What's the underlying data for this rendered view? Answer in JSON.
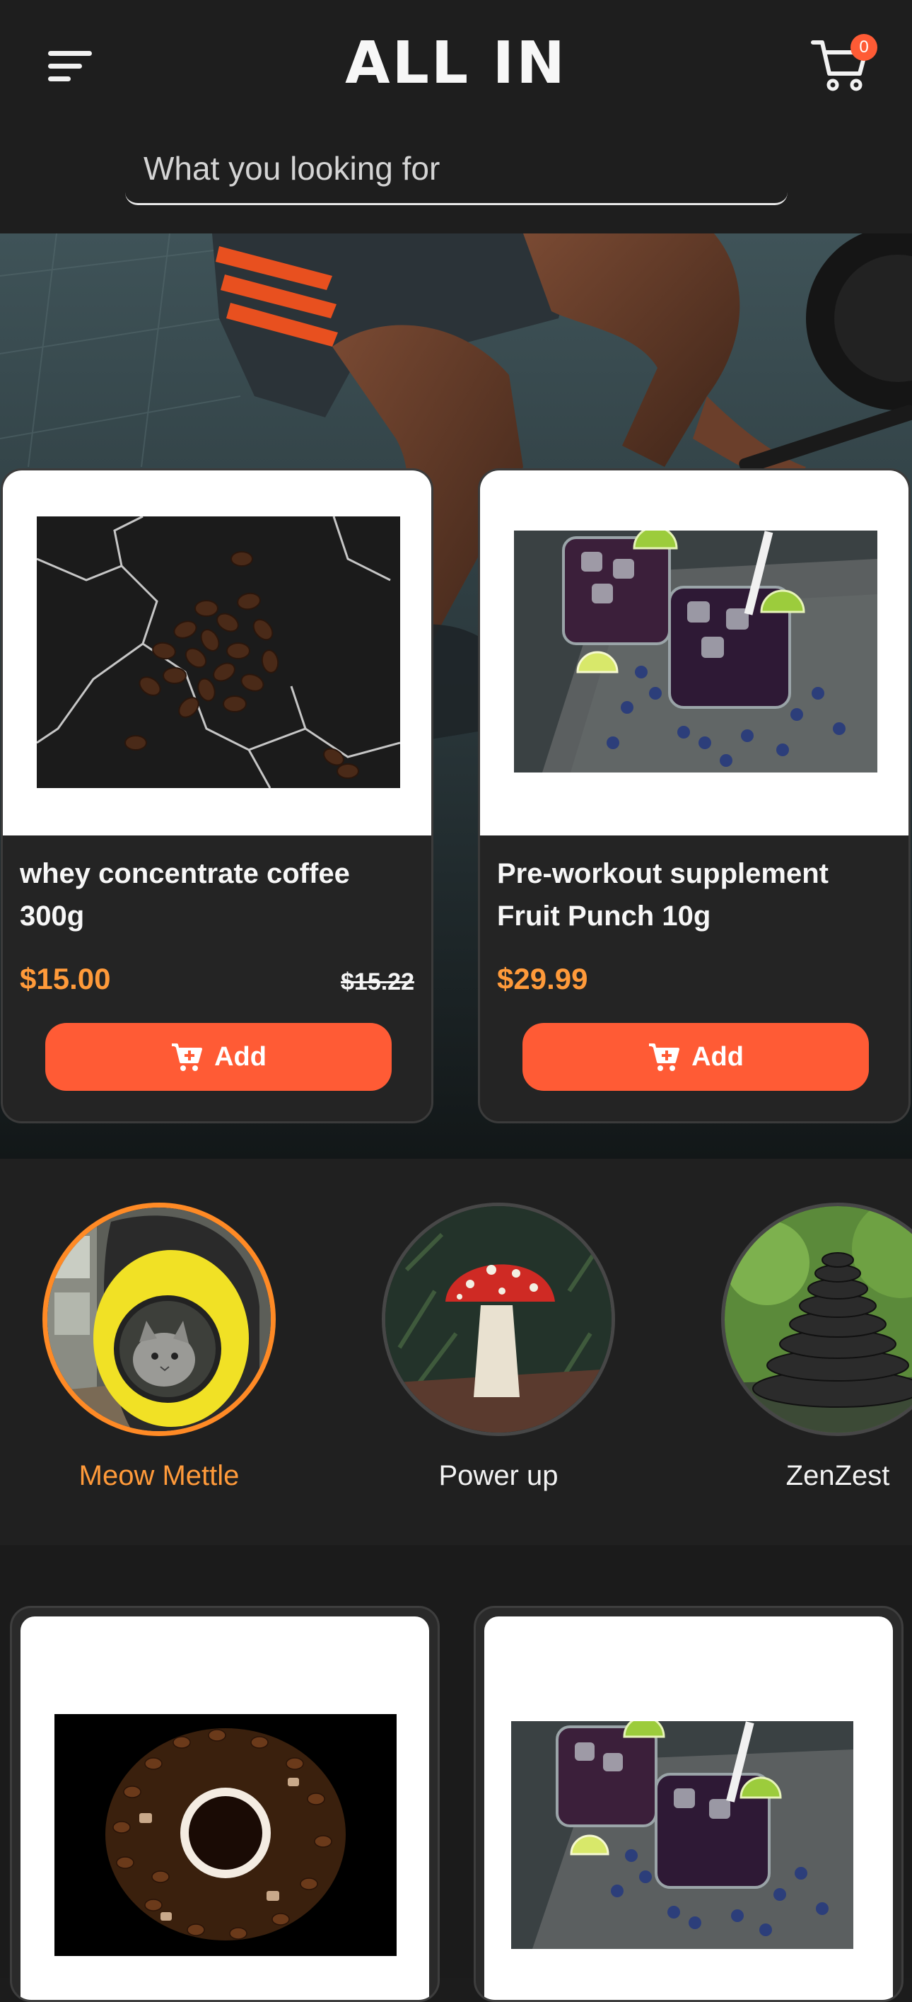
{
  "header": {
    "brand": "ALL IN",
    "cart_count": "0",
    "search_placeholder": "What you looking for"
  },
  "featured_products": [
    {
      "name": "whey concentrate coffee 300g",
      "price": "$15.00",
      "old_price": "$15.22",
      "add_label": "Add",
      "image": "coffee-beans-on-marble"
    },
    {
      "name": "Pre-workout supplement Fruit Punch 10g",
      "price": "$29.99",
      "add_label": "Add",
      "image": "berry-drinks-with-lime"
    }
  ],
  "categories": [
    {
      "label": "Meow Mettle",
      "active": true,
      "image": "cat-in-yellow-capsule"
    },
    {
      "label": "Power up",
      "active": false,
      "image": "red-mushroom"
    },
    {
      "label": "ZenZest",
      "active": false,
      "image": "stacked-stones"
    }
  ],
  "more_products": [
    {
      "image": "coffee-cup-on-beans"
    },
    {
      "image": "berry-drinks-with-lime"
    }
  ],
  "colors": {
    "background": "#1c1c1c",
    "accent": "#ff5b35",
    "price": "#ff9a3a",
    "active_ring": "#ff8a25",
    "card": "#242424"
  },
  "icons": [
    "menu-icon",
    "cart-icon",
    "cart-plus-icon"
  ]
}
